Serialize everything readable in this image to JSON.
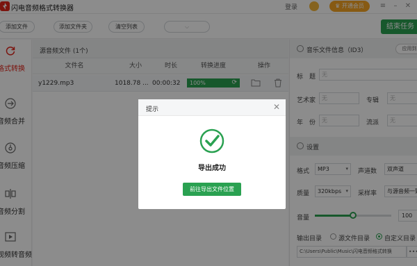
{
  "titlebar": {
    "app_title": "闪电音频格式转换器",
    "login": "登录",
    "vip": "开通会员"
  },
  "toolbar": {
    "add_file": "添加文件",
    "add_folder": "添加文件夹",
    "clear_list": "清空列表",
    "finish_task": "结束任务"
  },
  "sidebar": {
    "items": [
      {
        "label": "格式转换",
        "icon": "refresh-icon"
      },
      {
        "label": "音频合并",
        "icon": "merge-icon"
      },
      {
        "label": "音频压缩",
        "icon": "compress-icon"
      },
      {
        "label": "音频分割",
        "icon": "split-icon"
      },
      {
        "label": "视频转音频",
        "icon": "video-icon"
      }
    ]
  },
  "filelist": {
    "title": "源音频文件 (1个)",
    "columns": [
      "文件名",
      "大小",
      "时长",
      "转换进度",
      "操作"
    ],
    "rows": [
      {
        "name": "y1229.mp3",
        "size": "1018.78 ...",
        "duration": "00:00:32",
        "progress": "100%",
        "progress_value": 1.0
      }
    ]
  },
  "id3": {
    "title": "音乐文件信息（ID3）",
    "apply_all": "应用到",
    "label_title": "标　题",
    "label_artist": "艺术家",
    "label_album": "专辑",
    "label_year": "年　份",
    "label_genre": "流派",
    "placeholder": "无"
  },
  "settings": {
    "title": "设置",
    "format_label": "格式",
    "format_value": "MP3",
    "channel_label": "声道数",
    "channel_value": "双声道",
    "quality_label": "质量",
    "quality_value": "320kbps",
    "samplerate_label": "采样率",
    "samplerate_value": "与源音频一致",
    "volume_label": "音量",
    "volume_value": "100",
    "volume_fraction": 0.5,
    "output_label": "输出目录",
    "output_source": "源文件目录",
    "output_custom": "自定义目录",
    "output_path": "C:\\Users\\Public\\Music\\闪电音频格式转换",
    "more": "•••"
  },
  "dialog": {
    "title": "提示",
    "message": "导出成功",
    "button": "前往导出文件位置"
  }
}
